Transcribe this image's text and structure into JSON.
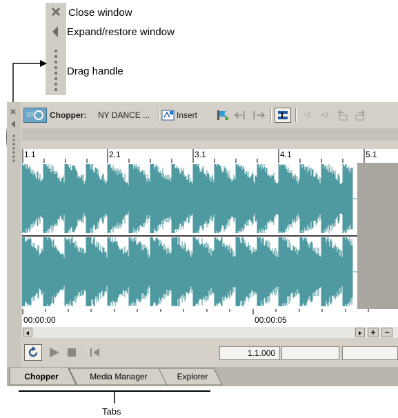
{
  "legend": {
    "close_label": "Close window",
    "expand_label": "Expand/restore window",
    "drag_label": "Drag handle"
  },
  "toolbar": {
    "app_label": "Chopper:",
    "file_name": "NY DANCE ...",
    "insert_label": "Insert"
  },
  "ruler": {
    "marks": [
      "1.1",
      "2.1",
      "3.1",
      "4.1",
      "5.1"
    ]
  },
  "timecodes": {
    "start": "00:00:00",
    "mid": "00:00:05"
  },
  "transport": {
    "position": "1.1.000"
  },
  "tabs": [
    {
      "label": "Chopper",
      "active": true
    },
    {
      "label": "Media Manager",
      "active": false
    },
    {
      "label": "Explorer",
      "active": false
    }
  ],
  "callouts": {
    "tabs_label": "Tabs"
  },
  "colors": {
    "waveform": "#4e9aa0",
    "chrome": "#d4d0c8"
  }
}
